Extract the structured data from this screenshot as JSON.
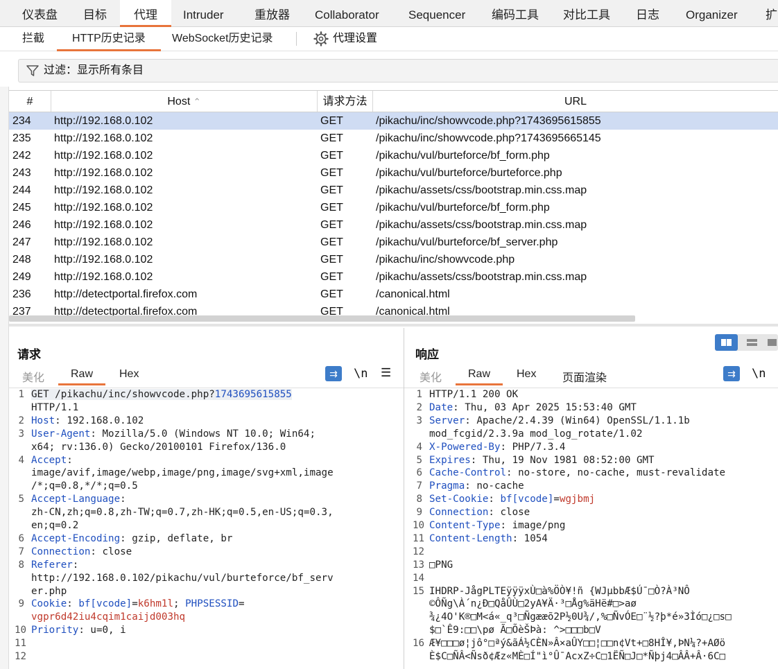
{
  "tabs": [
    "仪表盘",
    "目标",
    "代理",
    "Intruder",
    "重放器",
    "Collaborator",
    "Sequencer",
    "编码工具",
    "对比工具",
    "日志",
    "Organizer",
    "扩"
  ],
  "active_tab": "代理",
  "subtabs": [
    "拦截",
    "HTTP历史记录",
    "WebSocket历史记录",
    "代理设置"
  ],
  "active_subtab": "HTTP历史记录",
  "filter": "过滤：显示所有条目",
  "table": {
    "headers": {
      "num": "#",
      "host": "Host",
      "method": "请求方法",
      "url": "URL"
    },
    "rows": [
      {
        "num": "234",
        "host": "http://192.168.0.102",
        "method": "GET",
        "url": "/pikachu/inc/showvcode.php?1743695615855"
      },
      {
        "num": "235",
        "host": "http://192.168.0.102",
        "method": "GET",
        "url": "/pikachu/inc/showvcode.php?1743695665145"
      },
      {
        "num": "242",
        "host": "http://192.168.0.102",
        "method": "GET",
        "url": "/pikachu/vul/burteforce/bf_form.php"
      },
      {
        "num": "243",
        "host": "http://192.168.0.102",
        "method": "GET",
        "url": "/pikachu/vul/burteforce/burteforce.php"
      },
      {
        "num": "244",
        "host": "http://192.168.0.102",
        "method": "GET",
        "url": "/pikachu/assets/css/bootstrap.min.css.map"
      },
      {
        "num": "245",
        "host": "http://192.168.0.102",
        "method": "GET",
        "url": "/pikachu/vul/burteforce/bf_form.php"
      },
      {
        "num": "246",
        "host": "http://192.168.0.102",
        "method": "GET",
        "url": "/pikachu/assets/css/bootstrap.min.css.map"
      },
      {
        "num": "247",
        "host": "http://192.168.0.102",
        "method": "GET",
        "url": "/pikachu/vul/burteforce/bf_server.php"
      },
      {
        "num": "248",
        "host": "http://192.168.0.102",
        "method": "GET",
        "url": "/pikachu/inc/showvcode.php"
      },
      {
        "num": "249",
        "host": "http://192.168.0.102",
        "method": "GET",
        "url": "/pikachu/assets/css/bootstrap.min.css.map"
      },
      {
        "num": "236",
        "host": "http://detectportal.firefox.com",
        "method": "GET",
        "url": "/canonical.html"
      },
      {
        "num": "237",
        "host": "http://detectportal.firefox.com",
        "method": "GET",
        "url": "/canonical.html"
      }
    ]
  },
  "request": {
    "title": "请求",
    "tabs": [
      "美化",
      "Raw",
      "Hex"
    ],
    "active_tab": "Raw",
    "lines": [
      {
        "n": "1",
        "segs": [
          {
            "t": "GET /pikachu/inc/showvcode.php?",
            "c": ""
          },
          {
            "t": "1743695615855",
            "c": "k"
          }
        ]
      },
      {
        "n": "",
        "segs": [
          {
            "t": "HTTP/1.1",
            "c": ""
          }
        ]
      },
      {
        "n": "2",
        "segs": [
          {
            "t": "Host",
            "c": "k"
          },
          {
            "t": ": 192.168.0.102",
            "c": ""
          }
        ]
      },
      {
        "n": "3",
        "segs": [
          {
            "t": "User-Agent",
            "c": "k"
          },
          {
            "t": ": Mozilla/5.0 (Windows NT 10.0; Win64;",
            "c": ""
          }
        ]
      },
      {
        "n": "",
        "segs": [
          {
            "t": "x64; rv:136.0) Gecko/20100101 Firefox/136.0",
            "c": ""
          }
        ]
      },
      {
        "n": "4",
        "segs": [
          {
            "t": "Accept",
            "c": "k"
          },
          {
            "t": ":",
            "c": ""
          }
        ]
      },
      {
        "n": "",
        "segs": [
          {
            "t": "image/avif,image/webp,image/png,image/svg+xml,image",
            "c": ""
          }
        ]
      },
      {
        "n": "",
        "segs": [
          {
            "t": "/*;q=0.8,*/*;q=0.5",
            "c": ""
          }
        ]
      },
      {
        "n": "5",
        "segs": [
          {
            "t": "Accept-Language",
            "c": "k"
          },
          {
            "t": ":",
            "c": ""
          }
        ]
      },
      {
        "n": "",
        "segs": [
          {
            "t": "zh-CN,zh;q=0.8,zh-TW;q=0.7,zh-HK;q=0.5,en-US;q=0.3,",
            "c": ""
          }
        ]
      },
      {
        "n": "",
        "segs": [
          {
            "t": "en;q=0.2",
            "c": ""
          }
        ]
      },
      {
        "n": "6",
        "segs": [
          {
            "t": "Accept-Encoding",
            "c": "k"
          },
          {
            "t": ": gzip, deflate, br",
            "c": ""
          }
        ]
      },
      {
        "n": "7",
        "segs": [
          {
            "t": "Connection",
            "c": "k"
          },
          {
            "t": ": close",
            "c": ""
          }
        ]
      },
      {
        "n": "8",
        "segs": [
          {
            "t": "Referer",
            "c": "k"
          },
          {
            "t": ":",
            "c": ""
          }
        ]
      },
      {
        "n": "",
        "segs": [
          {
            "t": "http://192.168.0.102/pikachu/vul/burteforce/bf_serv",
            "c": ""
          }
        ]
      },
      {
        "n": "",
        "segs": [
          {
            "t": "er.php",
            "c": ""
          }
        ]
      },
      {
        "n": "9",
        "segs": [
          {
            "t": "Cookie",
            "c": "k"
          },
          {
            "t": ": ",
            "c": ""
          },
          {
            "t": "bf[vcode]",
            "c": "k"
          },
          {
            "t": "=",
            "c": ""
          },
          {
            "t": "k6hm1l",
            "c": "v"
          },
          {
            "t": "; ",
            "c": ""
          },
          {
            "t": "PHPSESSID",
            "c": "k"
          },
          {
            "t": "=",
            "c": ""
          }
        ]
      },
      {
        "n": "",
        "segs": [
          {
            "t": "vgpr6d42iu4cqim1caijd003hq",
            "c": "v"
          }
        ]
      },
      {
        "n": "10",
        "segs": [
          {
            "t": "Priority",
            "c": "k"
          },
          {
            "t": ": u=0, i",
            "c": ""
          }
        ]
      },
      {
        "n": "11",
        "segs": [
          {
            "t": "",
            "c": ""
          }
        ]
      },
      {
        "n": "12",
        "segs": [
          {
            "t": "",
            "c": ""
          }
        ]
      }
    ]
  },
  "response": {
    "title": "响应",
    "tabs": [
      "美化",
      "Raw",
      "Hex",
      "页面渲染"
    ],
    "active_tab": "Raw",
    "lines": [
      {
        "n": "1",
        "segs": [
          {
            "t": "HTTP/1.1 200 OK",
            "c": ""
          }
        ]
      },
      {
        "n": "2",
        "segs": [
          {
            "t": "Date",
            "c": "k"
          },
          {
            "t": ": Thu, 03 Apr 2025 15:53:40 GMT",
            "c": ""
          }
        ]
      },
      {
        "n": "3",
        "segs": [
          {
            "t": "Server",
            "c": "k"
          },
          {
            "t": ": Apache/2.4.39 (Win64) OpenSSL/1.1.1b",
            "c": ""
          }
        ]
      },
      {
        "n": "",
        "segs": [
          {
            "t": "mod_fcgid/2.3.9a mod_log_rotate/1.02",
            "c": ""
          }
        ]
      },
      {
        "n": "4",
        "segs": [
          {
            "t": "X-Powered-By",
            "c": "k"
          },
          {
            "t": ": PHP/7.3.4",
            "c": ""
          }
        ]
      },
      {
        "n": "5",
        "segs": [
          {
            "t": "Expires",
            "c": "k"
          },
          {
            "t": ": Thu, 19 Nov 1981 08:52:00 GMT",
            "c": ""
          }
        ]
      },
      {
        "n": "6",
        "segs": [
          {
            "t": "Cache-Control",
            "c": "k"
          },
          {
            "t": ": no-store, no-cache, must-revalidate",
            "c": ""
          }
        ]
      },
      {
        "n": "7",
        "segs": [
          {
            "t": "Pragma",
            "c": "k"
          },
          {
            "t": ": no-cache",
            "c": ""
          }
        ]
      },
      {
        "n": "8",
        "segs": [
          {
            "t": "Set-Cookie",
            "c": "k"
          },
          {
            "t": ": ",
            "c": ""
          },
          {
            "t": "bf[vcode]",
            "c": "k"
          },
          {
            "t": "=",
            "c": ""
          },
          {
            "t": "wgjbmj",
            "c": "v"
          }
        ]
      },
      {
        "n": "9",
        "segs": [
          {
            "t": "Connection",
            "c": "k"
          },
          {
            "t": ": close",
            "c": ""
          }
        ]
      },
      {
        "n": "10",
        "segs": [
          {
            "t": "Content-Type",
            "c": "k"
          },
          {
            "t": ": image/png",
            "c": ""
          }
        ]
      },
      {
        "n": "11",
        "segs": [
          {
            "t": "Content-Length",
            "c": "k"
          },
          {
            "t": ": 1054",
            "c": ""
          }
        ]
      },
      {
        "n": "12",
        "segs": [
          {
            "t": "",
            "c": ""
          }
        ]
      },
      {
        "n": "13",
        "segs": [
          {
            "t": "□PNG",
            "c": ""
          }
        ]
      },
      {
        "n": "14",
        "segs": [
          {
            "t": "",
            "c": ""
          }
        ]
      },
      {
        "n": "15",
        "segs": [
          {
            "t": "IHDRP-JågPLTEÿÿÿxÙ□à%ÖÒ¥!ñ {WJµbbÆ$Ú¯□Ò?À³NÔ",
            "c": ""
          }
        ]
      },
      {
        "n": "",
        "segs": [
          {
            "t": "©ÔÑg\\À´n¿Ð□QåÛÙ□2yA¥Ä·³□Åg%äHë#□>aø",
            "c": ""
          }
        ]
      },
      {
        "n": "",
        "segs": [
          {
            "t": "¾¿4O'K®□M<á«_q³□Ñgææõ2P½0U¾/,%□ÑvÓE□¨½?þ*é»3Ìó□¿□s□",
            "c": ""
          }
        ]
      },
      {
        "n": "",
        "segs": [
          {
            "t": "$□`Ê9:□□\\pø Ã□ÕèŠÞà: ^>□□□b□V",
            "c": ""
          }
        ]
      },
      {
        "n": "16",
        "segs": [
          {
            "t": "Æ¥□□□ø¦jô°□ªý&ãÁ½CÈN»Â×aÛY□□¦□□n¢Vt+□8HÎ¥,ÞN¼?+AØö",
            "c": ""
          }
        ]
      },
      {
        "n": "",
        "segs": [
          {
            "t": "È$C□ÑÂ<Ñsð¢Æz«MÈ□Í\"ì°Û¯AcxZ÷C□1ËÑ□J□*Ñþj4□ÂÂ+Â·6C□",
            "c": ""
          }
        ]
      }
    ]
  },
  "colors": {
    "accent": "#e8743b",
    "selected_row": "#cfdcf3",
    "key": "#1f4fbf",
    "value": "#c0392b"
  }
}
